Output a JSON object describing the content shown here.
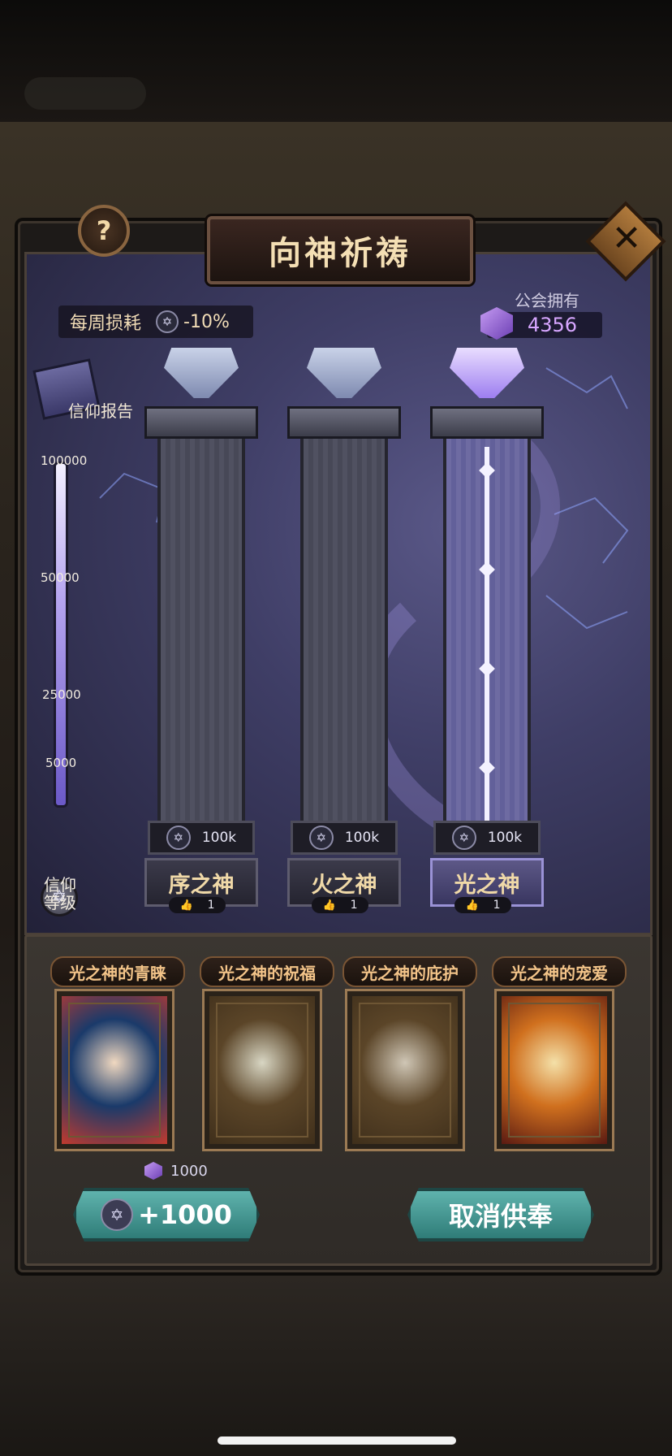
{
  "title": "向神祈祷",
  "help_icon": "?",
  "close_icon": "✕",
  "weekly_loss": {
    "label": "每周损耗",
    "icon": "✡",
    "value": "-10%"
  },
  "guild": {
    "label": "公会拥有",
    "value": "4356"
  },
  "report": {
    "label": "信仰报告"
  },
  "faith_scale": {
    "ticks": [
      "100000",
      "50000",
      "25000",
      "5000"
    ],
    "label": "信仰等级",
    "icon": "✡"
  },
  "pillars": [
    {
      "name": "序之神",
      "capacity": "100k",
      "count": "1",
      "icon": "✡"
    },
    {
      "name": "火之神",
      "capacity": "100k",
      "count": "1",
      "icon": "✡"
    },
    {
      "name": "光之神",
      "capacity": "100k",
      "count": "1",
      "icon": "✡"
    }
  ],
  "hand_icon": "👍",
  "cards": [
    {
      "title": "光之神的青睐",
      "colors": [
        "#1a3a6a",
        "#c23a2e",
        "#f0d8c0"
      ]
    },
    {
      "title": "光之神的祝福",
      "colors": [
        "#5b4528",
        "#3f2f1b",
        "#d8d6c3"
      ]
    },
    {
      "title": "光之神的庇护",
      "colors": [
        "#5b4528",
        "#3f2f1b",
        "#cfc6b5"
      ]
    },
    {
      "title": "光之神的宠爱",
      "colors": [
        "#d0701e",
        "#5a1a12",
        "#f4e0a8"
      ]
    }
  ],
  "cost": "1000",
  "actions": {
    "offer_label": "+1000",
    "offer_icon": "✡",
    "cancel_label": "取消供奉"
  },
  "palette": {
    "accent_teal": "#5fb3ad",
    "gem_purple": "#9a6ae0",
    "title_gold": "#f4dfb4"
  }
}
